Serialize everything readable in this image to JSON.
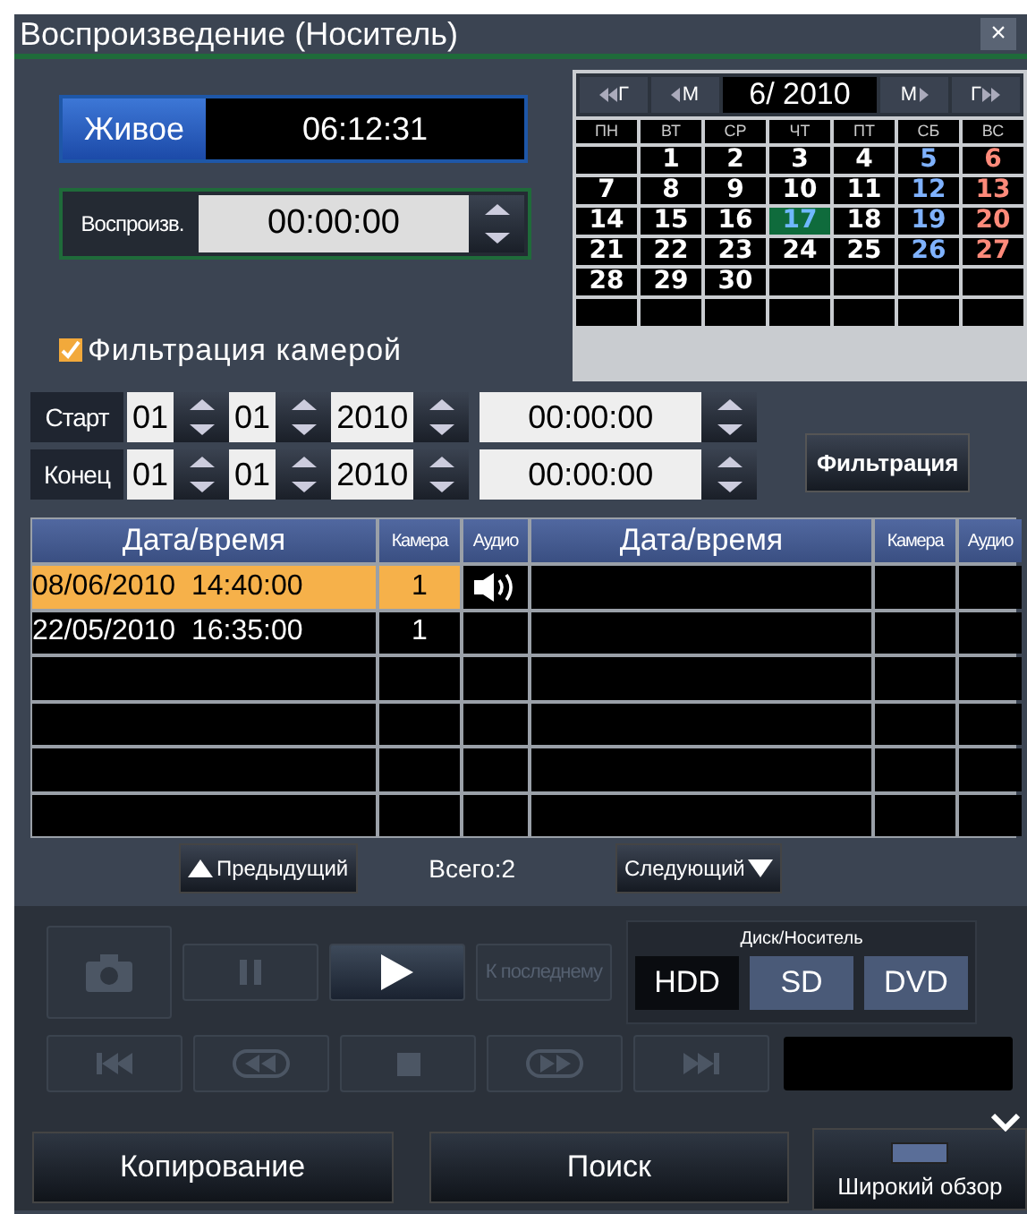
{
  "window": {
    "title": "Воспроизведение (Носитель)",
    "close": "×"
  },
  "live": {
    "label": "Живое",
    "time": "06:12:31"
  },
  "playback": {
    "label": "Воспроизв.",
    "time": "00:00:00"
  },
  "camera_filter": {
    "label": "Фильтрация камерой",
    "checked": true
  },
  "calendar": {
    "prev_year": "Г",
    "prev_month": "М",
    "month": "6/ 2010",
    "next_month": "М",
    "next_year": "Г",
    "weekdays": [
      "ПН",
      "ВТ",
      "СР",
      "ЧТ",
      "ПТ",
      "СБ",
      "ВС"
    ],
    "weeks": [
      [
        {
          "day": "1",
          "selected": false
        },
        {
          "day": "2",
          "selected": false
        },
        {
          "day": "3",
          "selected": false
        },
        {
          "day": "4",
          "selected": false
        },
        {
          "day": "5",
          "selected": false
        },
        {
          "day": "6",
          "selected": false
        }
      ],
      [
        {
          "day": "7",
          "selected": false
        },
        {
          "day": "8",
          "selected": false
        },
        {
          "day": "9",
          "selected": false
        },
        {
          "day": "10",
          "selected": false
        },
        {
          "day": "11",
          "selected": false
        },
        {
          "day": "12",
          "selected": false
        },
        {
          "day": "13",
          "selected": false
        }
      ],
      [
        {
          "day": "14",
          "selected": false
        },
        {
          "day": "15",
          "selected": false
        },
        {
          "day": "16",
          "selected": false
        },
        {
          "day": "17",
          "selected": true
        },
        {
          "day": "18",
          "selected": false
        },
        {
          "day": "19",
          "selected": false
        },
        {
          "day": "20",
          "selected": false
        }
      ],
      [
        {
          "day": "21",
          "selected": false
        },
        {
          "day": "22",
          "selected": false
        },
        {
          "day": "23",
          "selected": false
        },
        {
          "day": "24",
          "selected": false
        },
        {
          "day": "25",
          "selected": false
        },
        {
          "day": "26",
          "selected": false
        },
        {
          "day": "27",
          "selected": false
        }
      ],
      [
        {
          "day": "28",
          "selected": false
        },
        {
          "day": "29",
          "selected": false
        },
        {
          "day": "30",
          "selected": false
        }
      ]
    ]
  },
  "range": [
    {
      "label": "Старт",
      "day": "01",
      "month": "01",
      "year": "2010",
      "time": "00:00:00"
    },
    {
      "label": "Конец",
      "day": "01",
      "month": "01",
      "year": "2010",
      "time": "00:00:00"
    }
  ],
  "filter_button": "Фильтрация",
  "table": {
    "columns": [
      "Дата/время",
      "Камера",
      "Аудио",
      "Дата/время",
      "Камера",
      "Аудио"
    ],
    "rows": [
      {
        "date_time": "08/06/2010  14:40:00",
        "camera": "1",
        "audio": true,
        "selected": true
      },
      {
        "date_time": "22/05/2010  16:35:00",
        "camera": "1",
        "audio": false,
        "selected": false
      }
    ]
  },
  "pager": {
    "previous": "Предыдущий",
    "total": "Всего:2",
    "next": "Следующий"
  },
  "controls": [
    [
      {
        "kind": "snapshot",
        "disabled": true
      },
      {
        "kind": "pause",
        "disabled": true
      },
      {
        "kind": "play",
        "disabled": false
      },
      {
        "kind": "text",
        "label": "К последнему",
        "disabled": true
      }
    ],
    [
      {
        "kind": "first",
        "disabled": true
      },
      {
        "kind": "rewind",
        "disabled": true
      },
      {
        "kind": "stop",
        "disabled": true
      },
      {
        "kind": "forward",
        "disabled": true
      },
      {
        "kind": "last",
        "disabled": true
      }
    ]
  ],
  "disk": {
    "title": "Диск/Носитель",
    "options": [
      {
        "label": "HDD",
        "selected": true
      },
      {
        "label": "SD",
        "selected": false
      },
      {
        "label": "DVD",
        "selected": false
      }
    ]
  },
  "bottom": {
    "copy": "Копирование",
    "search": "Поиск",
    "wide_view": "Широкий обзор"
  }
}
